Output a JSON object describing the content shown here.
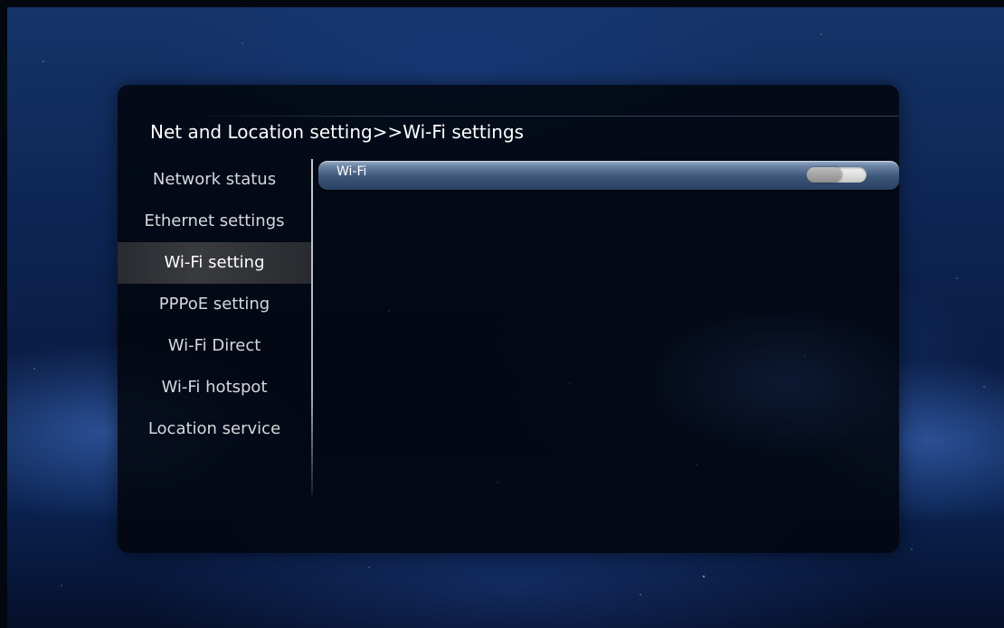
{
  "page": {
    "title": "Net and Location setting>>Wi-Fi settings"
  },
  "sidebar": {
    "items": [
      {
        "label": "Network status",
        "selected": false
      },
      {
        "label": "Ethernet settings",
        "selected": false
      },
      {
        "label": "Wi-Fi setting",
        "selected": true
      },
      {
        "label": "PPPoE setting",
        "selected": false
      },
      {
        "label": "Wi-Fi Direct",
        "selected": false
      },
      {
        "label": "Wi-Fi hotspot",
        "selected": false
      },
      {
        "label": "Location service",
        "selected": false
      }
    ]
  },
  "content": {
    "wifi": {
      "label": "Wi-Fi",
      "toggle_state": "off"
    }
  },
  "colors": {
    "row_highlight": "#4a6688",
    "panel_bg": "#02060e",
    "text": "#ffffff"
  }
}
